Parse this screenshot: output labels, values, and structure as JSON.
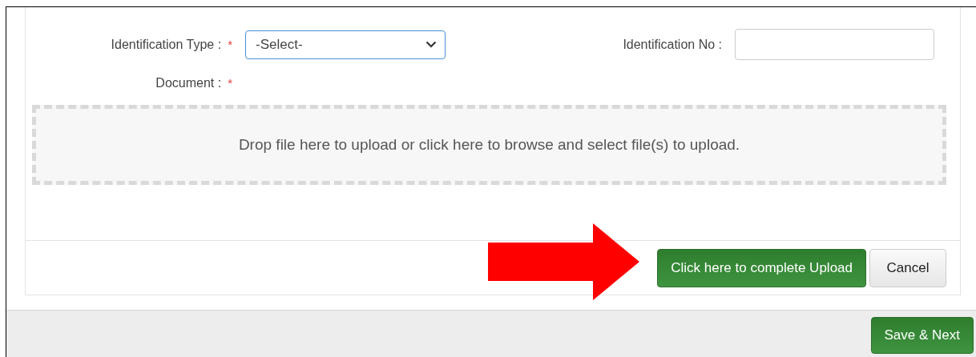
{
  "form": {
    "fields": [
      {
        "label": "Identification Type :",
        "required_mark": "*",
        "kind": "select",
        "value": "-Select-"
      },
      {
        "label": "Identification No :",
        "kind": "text"
      },
      {
        "label": "Document :",
        "required_mark": "*",
        "kind": "upload"
      }
    ]
  },
  "dropzone": {
    "text": "Drop file here to upload or click here to browse and select file(s) to upload."
  },
  "panel_buttons": [
    {
      "label": "Click here to complete Upload",
      "kind": "primary"
    },
    {
      "label": "Cancel",
      "kind": "default"
    }
  ],
  "footer_buttons": [
    {
      "label": "Save & Next",
      "kind": "primary"
    }
  ]
}
